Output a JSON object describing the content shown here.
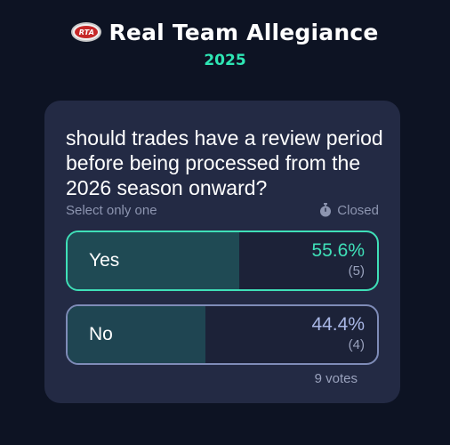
{
  "header": {
    "logo_text": "RTA",
    "title": "Real Team Allegiance",
    "year": "2025"
  },
  "poll": {
    "question": "should trades have a review period before being processed from the 2026 season onward?",
    "instruction": "Select only one",
    "status": "Closed",
    "status_icon": "stopwatch-icon",
    "options": [
      {
        "label": "Yes",
        "percent": "55.6%",
        "count": "(5)",
        "fraction": 0.556,
        "selected": true
      },
      {
        "label": "No",
        "percent": "44.4%",
        "count": "(4)",
        "fraction": 0.444,
        "selected": false
      }
    ],
    "total_votes": "9 votes"
  },
  "colors": {
    "background": "#0d1323",
    "card": "#232a44",
    "accent": "#2ee6b4",
    "selected_border": "#3fe0b8",
    "unselected_border": "#7f8cb8"
  }
}
